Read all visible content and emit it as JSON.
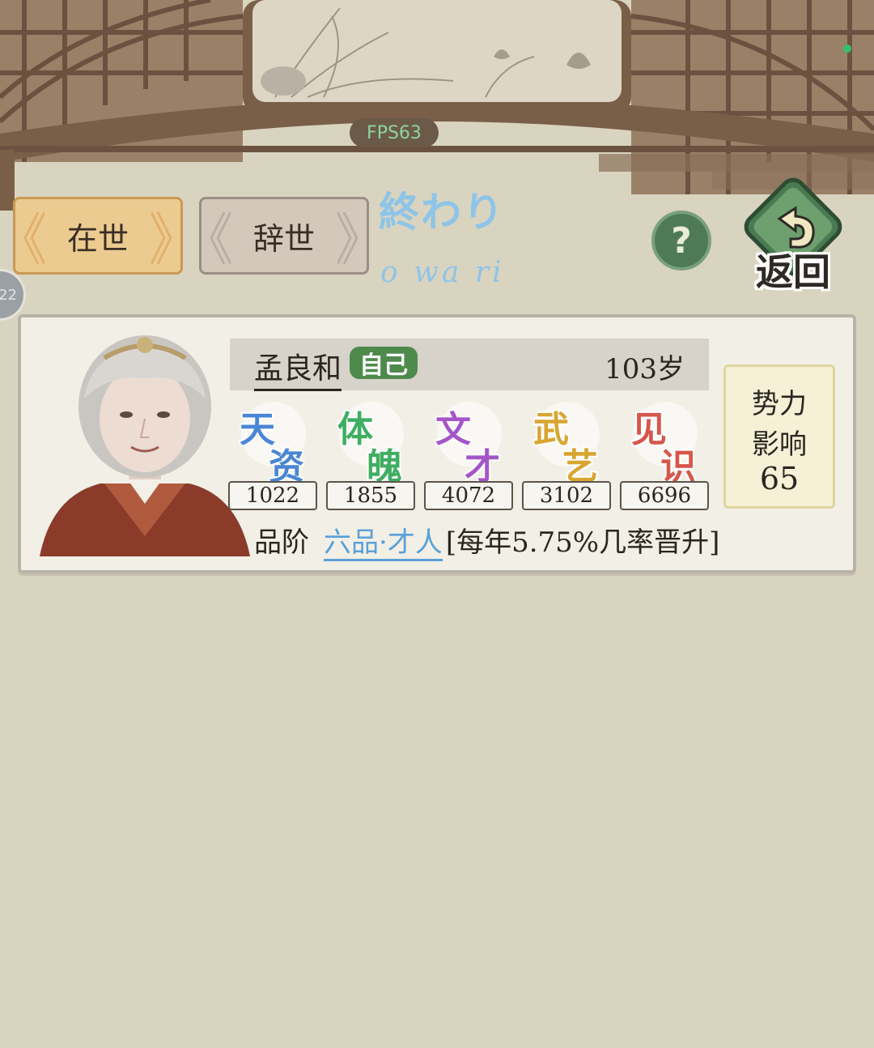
{
  "hud": {
    "fps": "FPS63"
  },
  "tabs": [
    {
      "label": "在世",
      "active": true
    },
    {
      "label": "辞世",
      "active": false
    }
  ],
  "title": {
    "japanese": "終わり",
    "romaji": "o wa ri"
  },
  "buttons": {
    "help": "?",
    "back": "返回"
  },
  "side_tab": {
    "label": "22"
  },
  "character": {
    "name": "孟良和",
    "badge": "自己",
    "age": "103岁",
    "stats": [
      {
        "c1": "天",
        "c2": "资",
        "value": "1022",
        "color": "#4a86d6"
      },
      {
        "c1": "体",
        "c2": "魄",
        "value": "1855",
        "color": "#3fae62"
      },
      {
        "c1": "文",
        "c2": "才",
        "value": "4072",
        "color": "#a455c8"
      },
      {
        "c1": "武",
        "c2": "艺",
        "value": "3102",
        "color": "#d9a531"
      },
      {
        "c1": "见",
        "c2": "识",
        "value": "6696",
        "color": "#d5574a"
      }
    ],
    "power": {
      "line1": "势力",
      "line2": "影响",
      "value": "65"
    },
    "rank": {
      "label": "品阶",
      "value": "六品·才人",
      "note": "[每年5.75%几率晋升]"
    }
  },
  "colors": {
    "background": "#d9d4c0",
    "frame_wood": "#7a5f48",
    "accent_blue": "#8ec4e8",
    "button_green": "#4f7a56"
  }
}
